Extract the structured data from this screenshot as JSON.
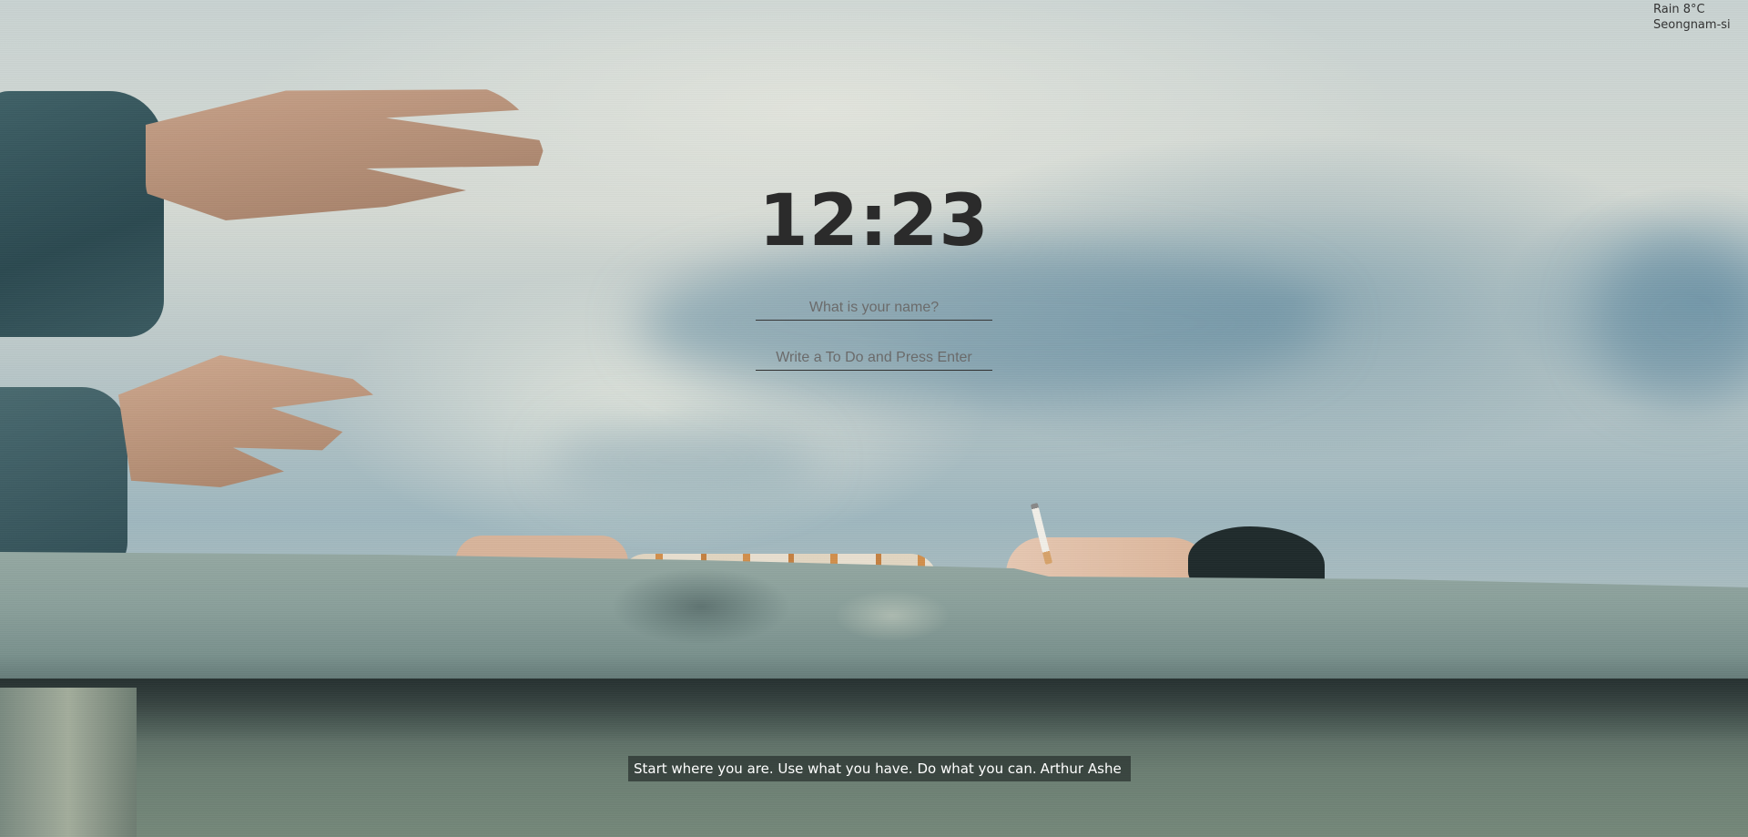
{
  "weather": {
    "condition_temp": "Rain 8°C",
    "location": "Seongnam-si"
  },
  "clock": {
    "time": "12:23"
  },
  "name_form": {
    "placeholder": "What is your name?"
  },
  "todo_form": {
    "placeholder": "Write a To Do and Press Enter"
  },
  "quote": {
    "text": "Start where you are. Use what you have. Do what you can.",
    "author": "Arthur Ashe"
  }
}
